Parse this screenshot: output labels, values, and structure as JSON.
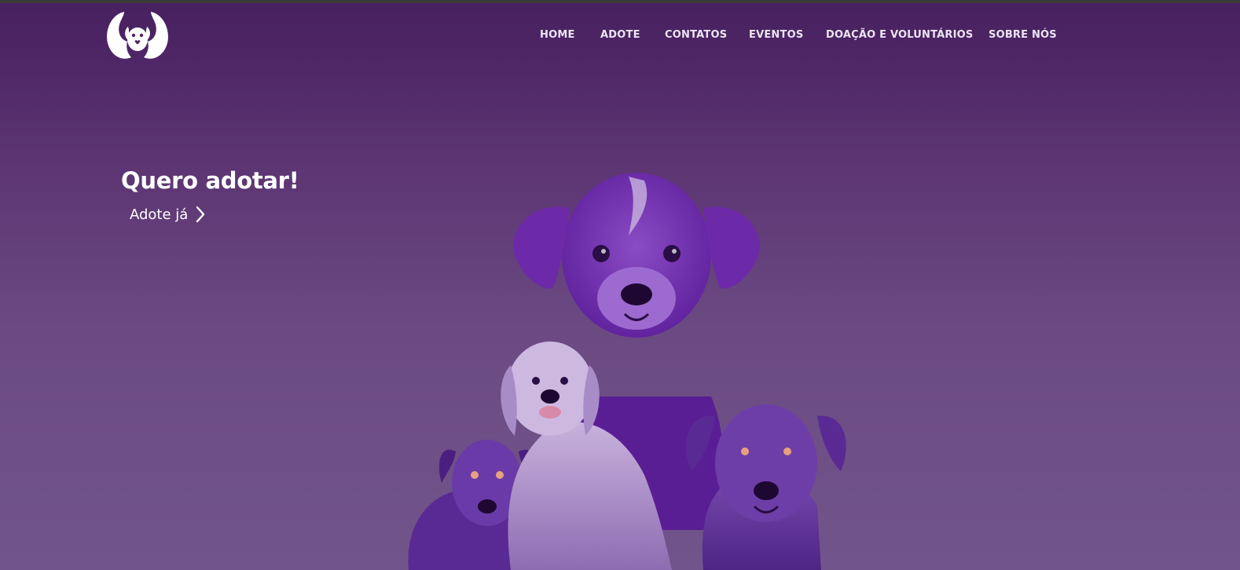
{
  "brand": {
    "logo_icon": "dog-in-hands-icon"
  },
  "nav": {
    "items": [
      {
        "label": "HOME"
      },
      {
        "label": "ADOTE"
      },
      {
        "label": "CONTATOS"
      },
      {
        "label": "EVENTOS"
      },
      {
        "label": "DOAÇÃO E VOLUNTÁRIOS"
      },
      {
        "label": "SOBRE NÓS"
      }
    ]
  },
  "hero": {
    "title": "Quero adotar!",
    "link_label": "Adote já",
    "link_icon": "chevron-right-icon",
    "image_icon": "dogs-illustration"
  },
  "colors": {
    "background_top": "#47205f",
    "background_bottom": "#71558a",
    "nav_text": "#ece4f2",
    "text": "#ffffff",
    "dog_purple": "#6a2aa8"
  }
}
